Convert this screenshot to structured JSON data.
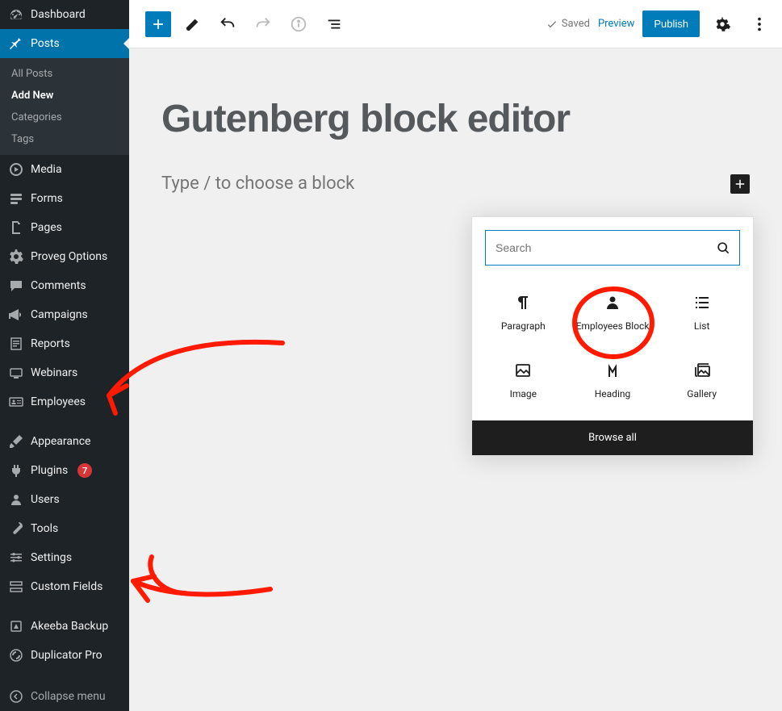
{
  "sidebar": {
    "items": [
      {
        "label": "Dashboard"
      },
      {
        "label": "Posts"
      },
      {
        "label": "Media"
      },
      {
        "label": "Forms"
      },
      {
        "label": "Pages"
      },
      {
        "label": "Proveg Options"
      },
      {
        "label": "Comments"
      },
      {
        "label": "Campaigns"
      },
      {
        "label": "Reports"
      },
      {
        "label": "Webinars"
      },
      {
        "label": "Employees"
      },
      {
        "label": "Appearance"
      },
      {
        "label": "Plugins",
        "badge": "7"
      },
      {
        "label": "Users"
      },
      {
        "label": "Tools"
      },
      {
        "label": "Settings"
      },
      {
        "label": "Custom Fields"
      },
      {
        "label": "Akeeba Backup"
      },
      {
        "label": "Duplicator Pro"
      }
    ],
    "submenu": {
      "items": [
        {
          "label": "All Posts"
        },
        {
          "label": "Add New"
        },
        {
          "label": "Categories"
        },
        {
          "label": "Tags"
        }
      ]
    },
    "collapse_label": "Collapse menu"
  },
  "topbar": {
    "saved_label": "Saved",
    "preview_label": "Preview",
    "publish_label": "Publish"
  },
  "editor": {
    "post_title": "Gutenberg block editor",
    "placeholder": "Type / to choose a block"
  },
  "inserter": {
    "search_placeholder": "Search",
    "items": [
      {
        "label": "Paragraph"
      },
      {
        "label": "Employees Block"
      },
      {
        "label": "List"
      },
      {
        "label": "Image"
      },
      {
        "label": "Heading"
      },
      {
        "label": "Gallery"
      }
    ],
    "browse_all_label": "Browse all"
  }
}
